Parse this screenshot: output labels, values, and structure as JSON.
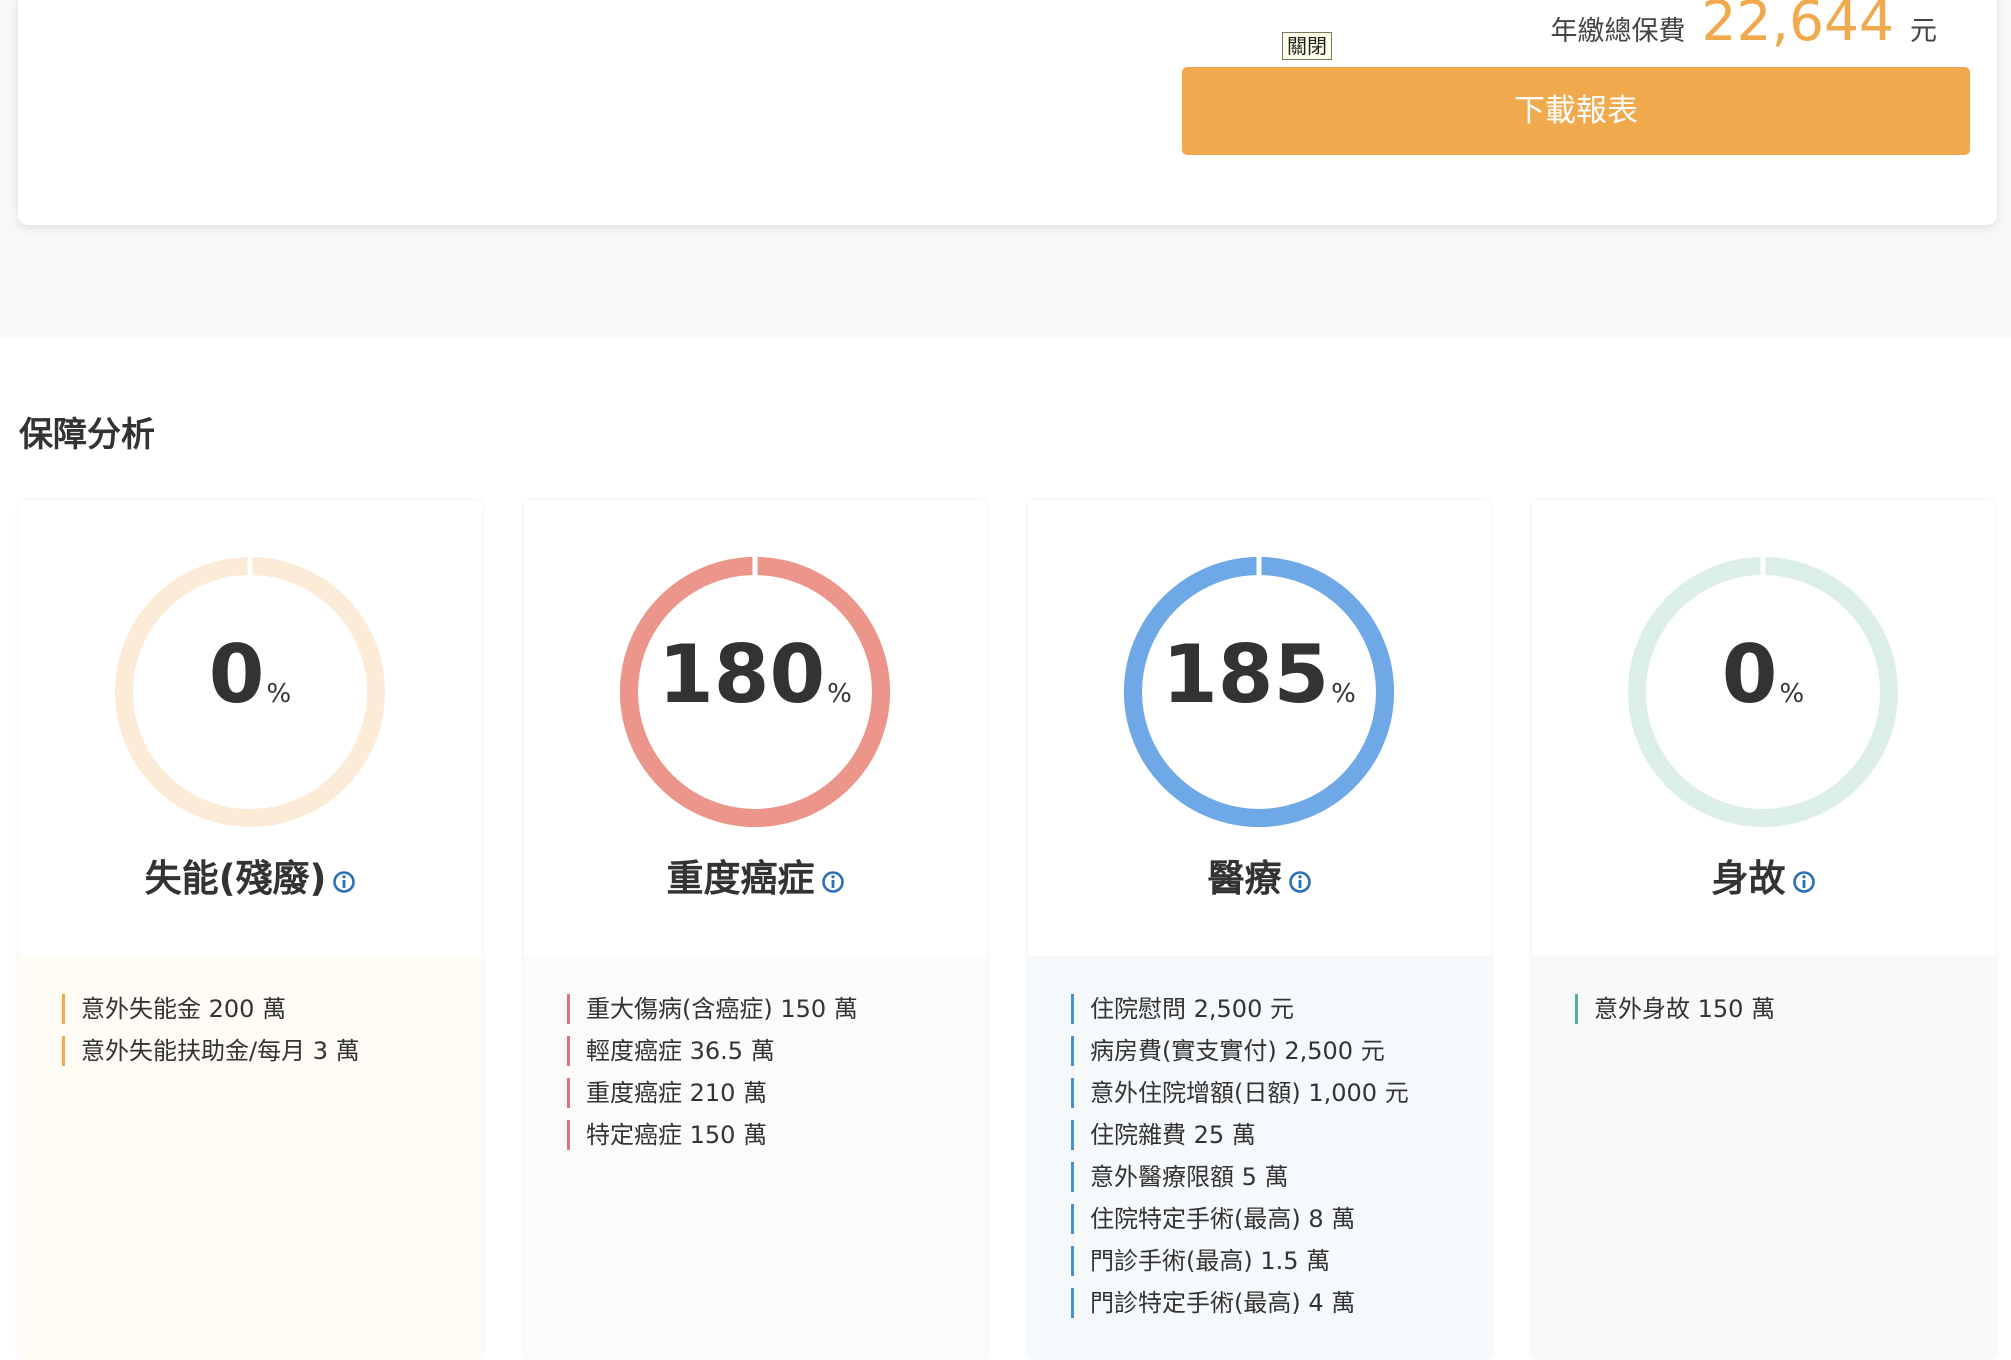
{
  "header": {
    "premium_label": "年繳總保費",
    "premium_amount": "22,644",
    "premium_unit": "元",
    "close_label": "關閉",
    "download_label": "下載報表"
  },
  "analysis": {
    "title": "保障分析",
    "percent_symbol": "%",
    "cards": [
      {
        "title": "失能(殘廢)",
        "percent": "0",
        "progress_fraction": 0,
        "ring_color": "#fcebd6",
        "accent_color": "#f1a94e",
        "bottom_bg": "#fffbf5",
        "items": [
          "意外失能金 200 萬",
          "意外失能扶助金/每月 3 萬"
        ]
      },
      {
        "title": "重度癌症",
        "percent": "180",
        "progress_fraction": 1,
        "ring_color": "#ec958a",
        "accent_color": "#e0737a",
        "bottom_bg": "#fcfbfa",
        "items": [
          "重大傷病(含癌症) 150 萬",
          "輕度癌症 36.5 萬",
          "重度癌症 210 萬",
          "特定癌症 150 萬"
        ]
      },
      {
        "title": "醫療",
        "percent": "185",
        "progress_fraction": 1,
        "ring_color": "#6ea8e7",
        "accent_color": "#4a8fd8",
        "bottom_bg": "#f6f9fc",
        "items": [
          "住院慰問 2,500 元",
          "病房費(實支實付) 2,500 元",
          "意外住院增額(日額) 1,000 元",
          "住院雜費 25 萬",
          "意外醫療限額 5 萬",
          "住院特定手術(最高) 8 萬",
          "門診手術(最高) 1.5 萬",
          "門診特定手術(最高) 4 萬"
        ]
      },
      {
        "title": "身故",
        "percent": "0",
        "progress_fraction": 0,
        "ring_color": "#dcefe7",
        "accent_color": "#56b28a",
        "bottom_bg": "#f7faf9",
        "items": [
          "意外身故 150 萬"
        ]
      }
    ]
  }
}
